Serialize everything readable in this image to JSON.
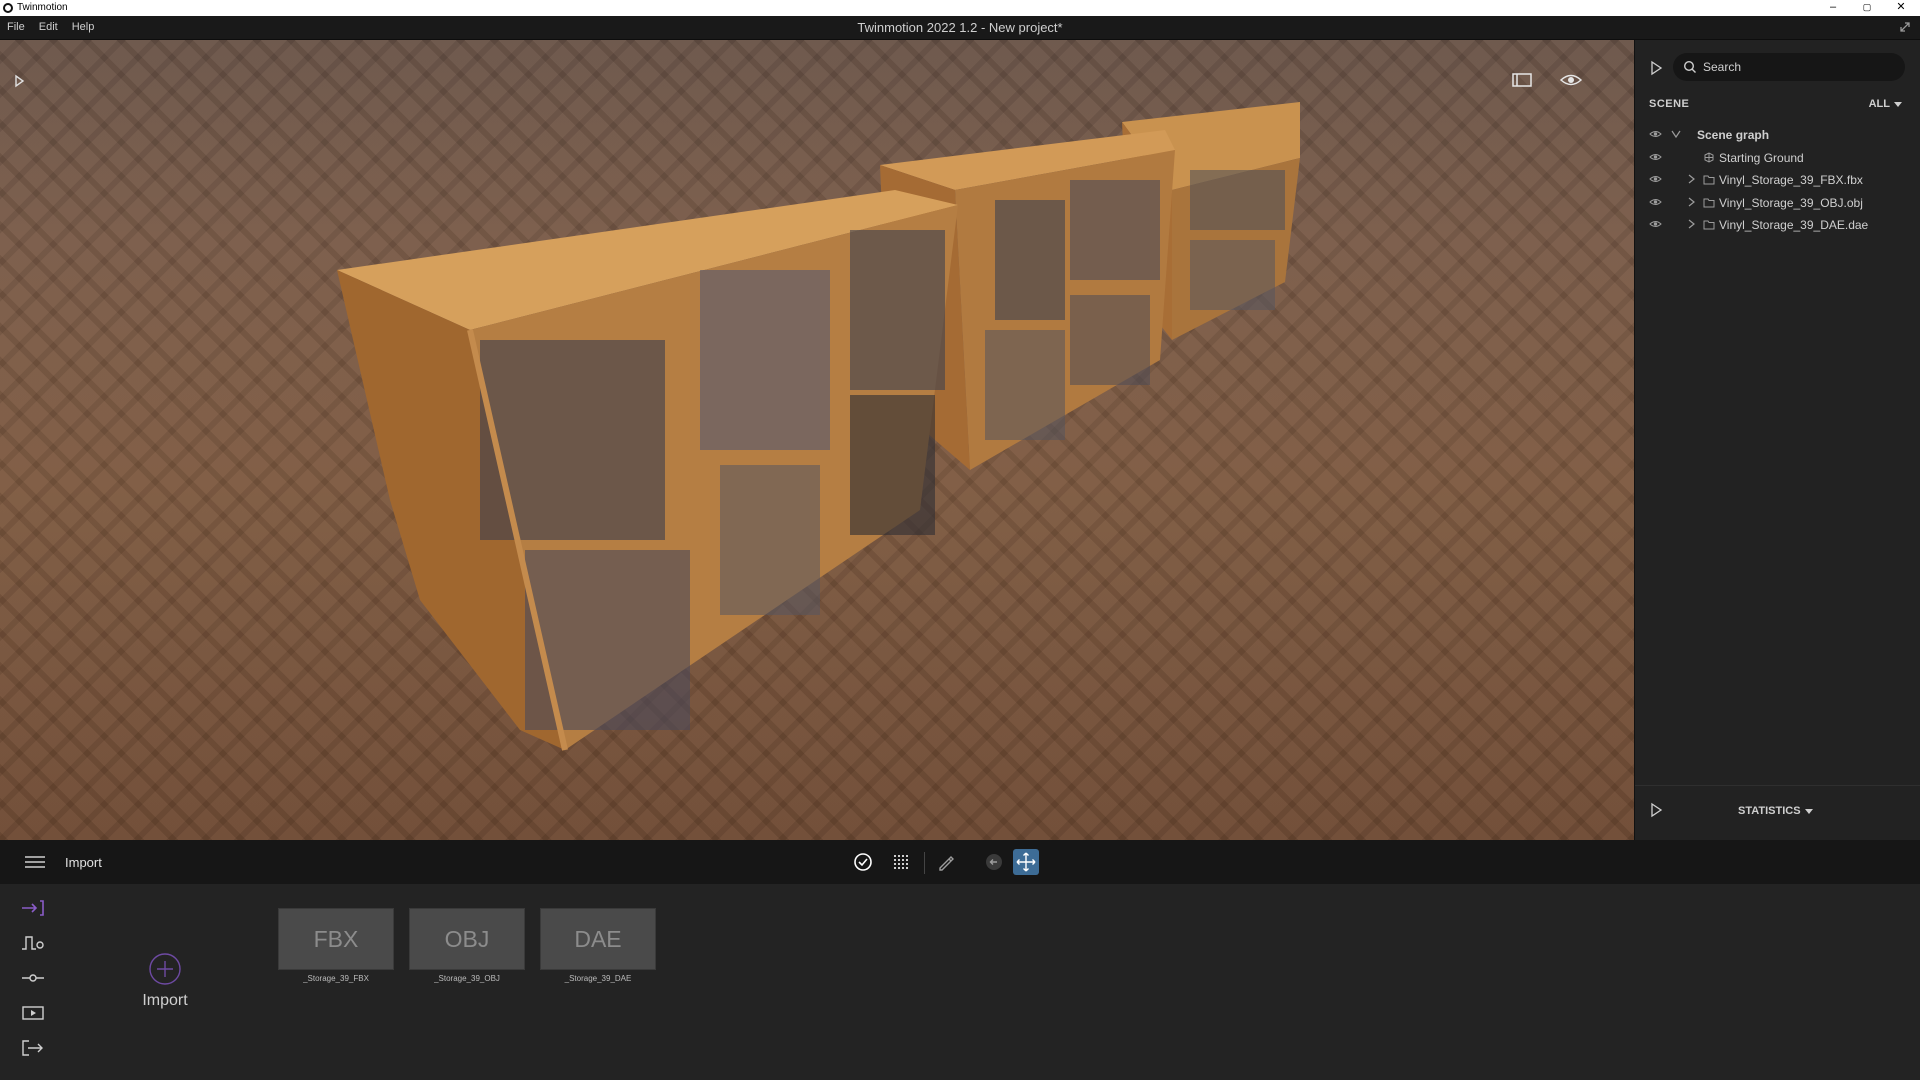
{
  "os": {
    "app_name": "Twinmotion",
    "minimize": "–",
    "maximize": "▢",
    "close": "✕"
  },
  "header": {
    "menu": [
      "File",
      "Edit",
      "Help"
    ],
    "title": "Twinmotion 2022 1.2 - New project*"
  },
  "right_panel": {
    "search_placeholder": "Search",
    "scene_label": "SCENE",
    "filter_label": "ALL",
    "tree": [
      {
        "label": "Scene graph",
        "icon": "chevron-down-icon"
      },
      {
        "label": "Starting Ground",
        "icon": "ground-icon"
      },
      {
        "label": "Vinyl_Storage_39_FBX.fbx",
        "icon": "folder-icon"
      },
      {
        "label": "Vinyl_Storage_39_OBJ.obj",
        "icon": "folder-icon"
      },
      {
        "label": "Vinyl_Storage_39_DAE.dae",
        "icon": "folder-icon"
      }
    ],
    "statistics_label": "STATISTICS"
  },
  "toolbar": {
    "section_title": "Import"
  },
  "bottom_panel": {
    "import_label": "Import",
    "assets": [
      {
        "format": "FBX",
        "caption": "_Storage_39_FBX"
      },
      {
        "format": "OBJ",
        "caption": "_Storage_39_OBJ"
      },
      {
        "format": "DAE",
        "caption": "_Storage_39_DAE"
      }
    ]
  },
  "colors": {
    "accent": "#8a5cc7",
    "active_tool": "#3d6c96",
    "panel_bg": "#222222",
    "viewport_floor": "#7a5b48"
  }
}
